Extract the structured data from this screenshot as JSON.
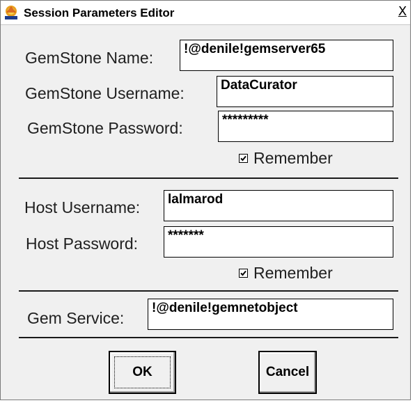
{
  "window": {
    "title": "Session Parameters Editor",
    "close_label": "X",
    "app_icon": "vast-logo-icon"
  },
  "gemstone": {
    "name_label": "GemStone Name:",
    "name_value": "!@denile!gemserver65",
    "username_label": "GemStone Username:",
    "username_value": "DataCurator",
    "password_label": "GemStone Password:",
    "password_value": "*********",
    "remember_label": "Remember",
    "remember_checked": true
  },
  "host": {
    "username_label": "Host Username:",
    "username_value": "lalmarod",
    "password_label": "Host Password:",
    "password_value": "*******",
    "remember_label": "Remember",
    "remember_checked": true
  },
  "service": {
    "label": "Gem Service:",
    "value": "!@denile!gemnetobject"
  },
  "buttons": {
    "ok_label": "OK",
    "cancel_label": "Cancel"
  }
}
